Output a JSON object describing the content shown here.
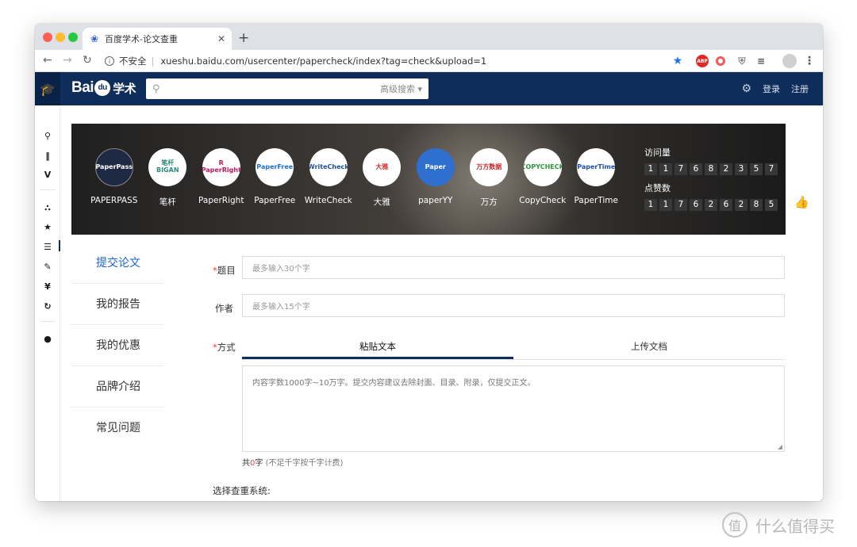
{
  "browser": {
    "tab_title": "百度学术-论文查重",
    "tab_favicon": "baidu-paw-icon",
    "new_tab": "+",
    "insecure_label": "不安全",
    "url": "xueshu.baidu.com/usercenter/papercheck/index?tag=check&upload=1",
    "extensions": [
      "ABP"
    ]
  },
  "header": {
    "logo_prefix": "Bai",
    "logo_paw": "du",
    "logo_suffix": "学术",
    "search_placeholder": "",
    "advanced_search": "高级搜索 ▾",
    "login": "登录",
    "register": "注册"
  },
  "banner": {
    "brands": [
      {
        "name": "PAPERPASS",
        "logo": "PaperPass",
        "color": "#1e2a44",
        "text_color": "#ffffff"
      },
      {
        "name": "笔杆",
        "logo": "笔杆\nBIGAN",
        "color": "#ffffff",
        "text_color": "#2a8a7a"
      },
      {
        "name": "PaperRight",
        "logo": "R\nPaperRight",
        "color": "#ffffff",
        "text_color": "#c2185b"
      },
      {
        "name": "PaperFree",
        "logo": "PaperFree",
        "color": "#ffffff",
        "text_color": "#1e6fd6"
      },
      {
        "name": "WriteCheck",
        "logo": "WriteCheck",
        "color": "#ffffff",
        "text_color": "#1d4e9c"
      },
      {
        "name": "大雅",
        "logo": "大雅",
        "color": "#ffffff",
        "text_color": "#d32f2f"
      },
      {
        "name": "paperYY",
        "logo": "Paper",
        "color": "#2f6fcf",
        "text_color": "#ffffff"
      },
      {
        "name": "万方",
        "logo": "万方数据",
        "color": "#ffffff",
        "text_color": "#c62828"
      },
      {
        "name": "CopyCheck",
        "logo": "COPYCHECK",
        "color": "#ffffff",
        "text_color": "#2e9a3a"
      },
      {
        "name": "PaperTime",
        "logo": "PaperTime",
        "color": "#ffffff",
        "text_color": "#1e4fb0"
      }
    ],
    "visits_label": "访问量",
    "visits_digits": [
      "1",
      "1",
      "7",
      "6",
      "8",
      "2",
      "3",
      "5",
      "7"
    ],
    "likes_label": "点赞数",
    "likes_digits": [
      "1",
      "1",
      "7",
      "6",
      "2",
      "6",
      "2",
      "8",
      "5"
    ]
  },
  "subnav": {
    "items": [
      "提交论文",
      "我的报告",
      "我的优惠",
      "品牌介绍",
      "常见问题"
    ],
    "active": "提交论文"
  },
  "form": {
    "title_label": "题目",
    "title_placeholder": "最多输入30个字",
    "author_label": "作者",
    "author_placeholder": "最多输入15个字",
    "mode_label": "方式",
    "tab_paste": "粘贴文本",
    "tab_upload": "上传文档",
    "textarea_placeholder": "内容字数1000字~10万字。提交内容建议去除封面、目录、附录，仅提交正文。",
    "counter_prefix": "共",
    "counter_value": "0",
    "counter_suffix": "字",
    "counter_note": "(不足千字按千字计费)",
    "choose_system": "选择查重系统:"
  },
  "watermark": {
    "glyph": "值",
    "text": "什么值得买"
  }
}
